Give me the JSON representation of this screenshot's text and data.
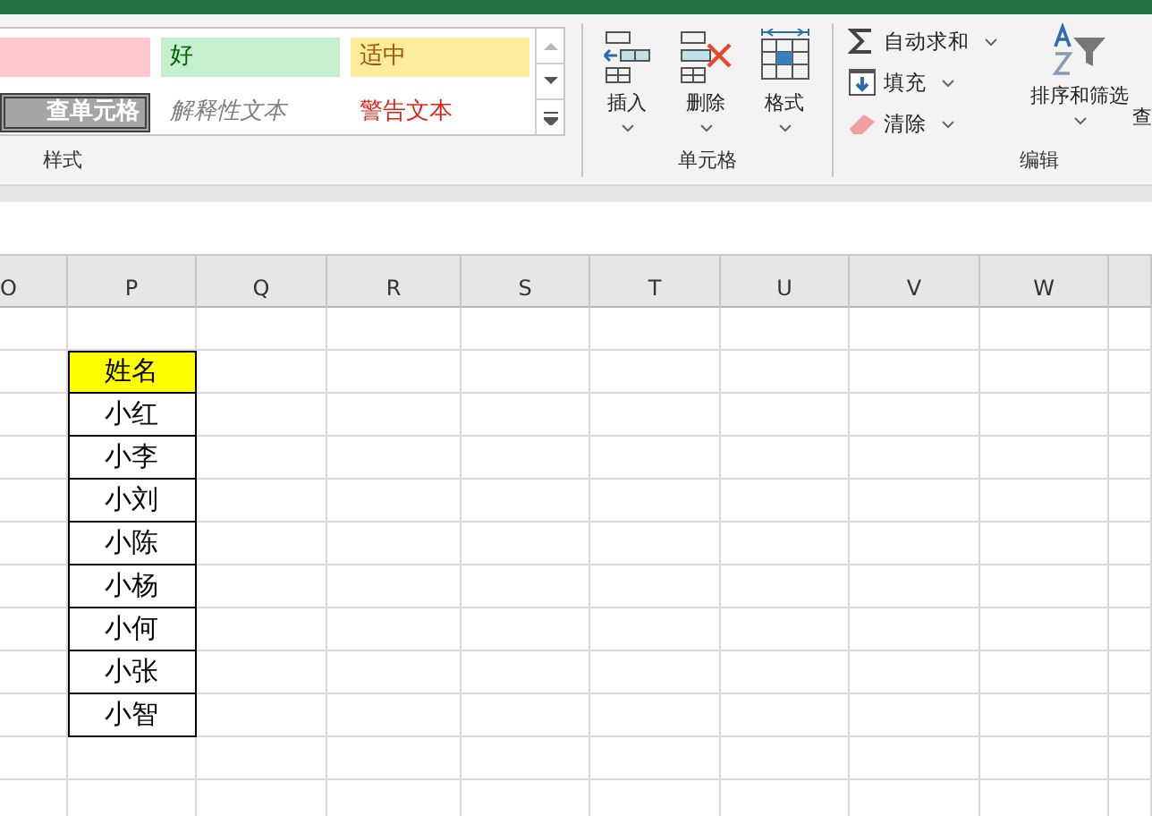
{
  "ribbon": {
    "styles_group": {
      "label": "样式",
      "items": [
        {
          "kind": "bad"
        },
        {
          "kind": "good",
          "text": "好"
        },
        {
          "kind": "neutral",
          "text": "适中"
        },
        {
          "kind": "check",
          "text": "查单元格"
        },
        {
          "kind": "explanatory",
          "text": "解释性文本"
        },
        {
          "kind": "warning",
          "text": "警告文本"
        }
      ]
    },
    "cells_group": {
      "label": "单元格",
      "buttons": [
        {
          "kind": "insert",
          "label": "插入"
        },
        {
          "kind": "delete",
          "label": "删除"
        },
        {
          "kind": "format",
          "label": "格式"
        }
      ]
    },
    "editing_group": {
      "label": "编辑",
      "commands": [
        {
          "kind": "sum",
          "label": "自动求和"
        },
        {
          "kind": "fill",
          "label": "填充"
        },
        {
          "kind": "clear",
          "label": "清除"
        }
      ],
      "sort_button": "排序和筛选",
      "find_button": "查"
    }
  },
  "sheet": {
    "columns": [
      "O",
      "P",
      "Q",
      "R",
      "S",
      "T",
      "U",
      "V",
      "W"
    ],
    "header": "姓名",
    "names": [
      "小红",
      "小李",
      "小刘",
      "小陈",
      "小杨",
      "小何",
      "小张",
      "小智"
    ]
  }
}
